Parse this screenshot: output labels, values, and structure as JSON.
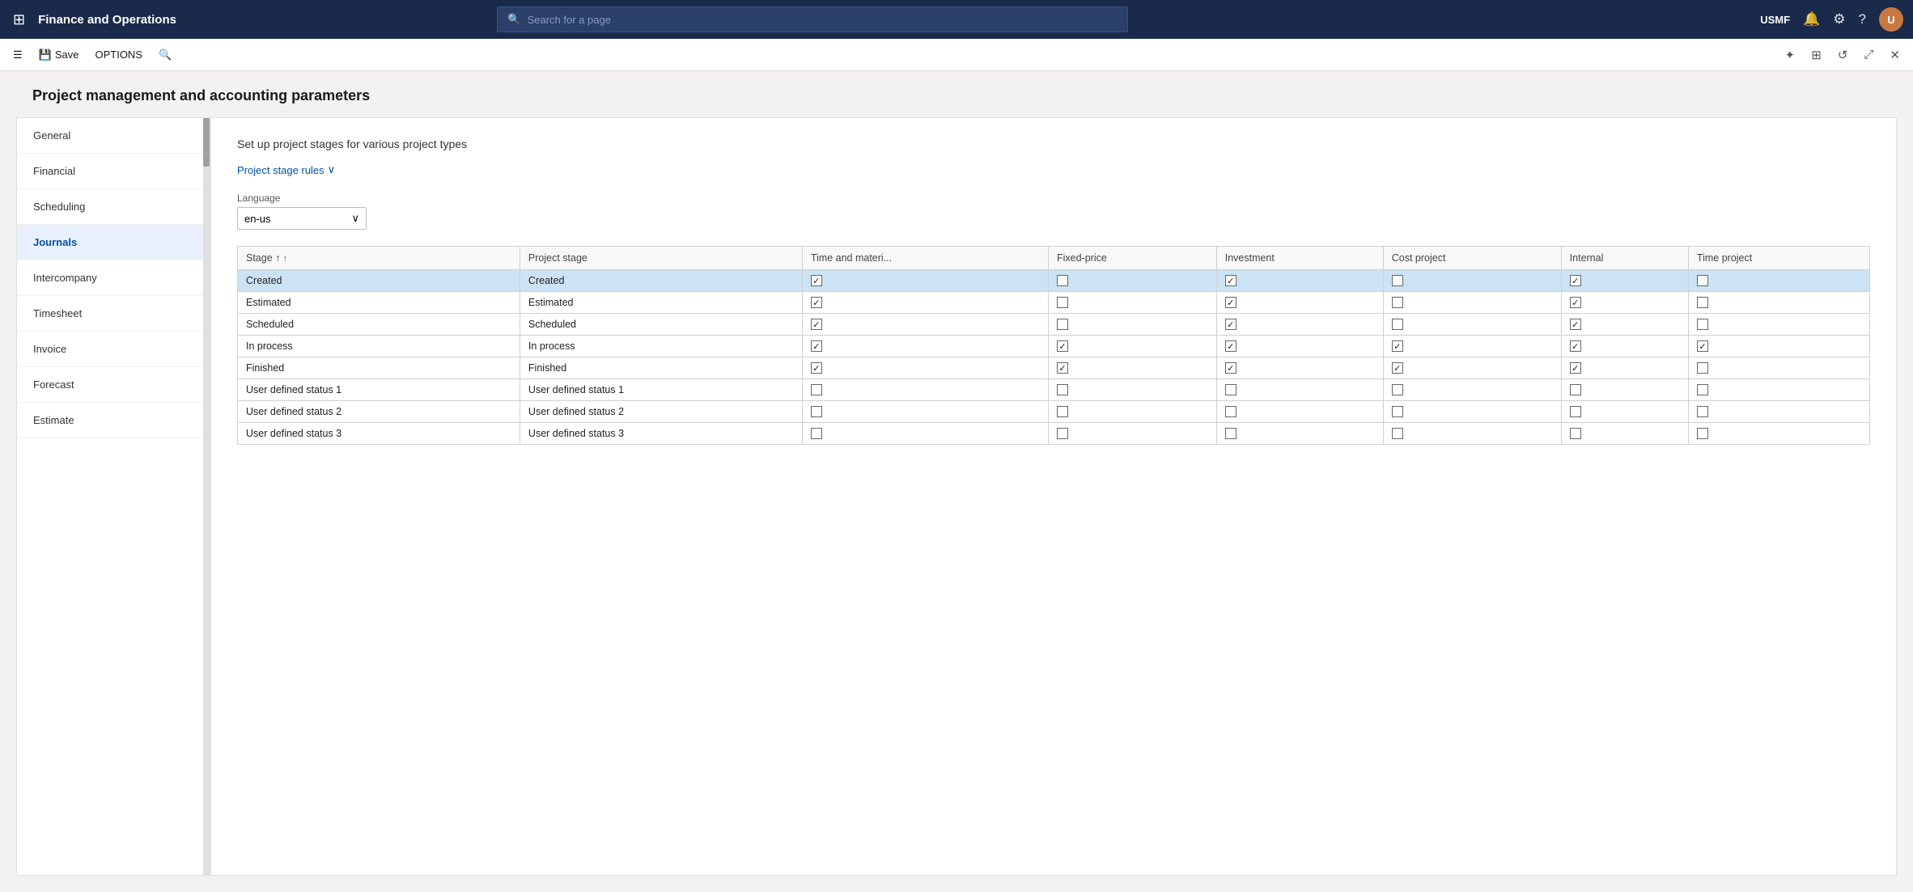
{
  "topbar": {
    "title": "Finance and Operations",
    "search_placeholder": "Search for a page",
    "user": "USMF"
  },
  "actionbar": {
    "save_label": "Save",
    "options_label": "OPTIONS"
  },
  "page": {
    "title": "Project management and accounting parameters",
    "section_heading": "Set up project stages for various project types",
    "project_stage_rules_label": "Project stage rules",
    "language_label": "Language",
    "language_value": "en-us"
  },
  "sidebar": {
    "items": [
      {
        "id": "general",
        "label": "General"
      },
      {
        "id": "financial",
        "label": "Financial"
      },
      {
        "id": "scheduling",
        "label": "Scheduling"
      },
      {
        "id": "journals",
        "label": "Journals"
      },
      {
        "id": "intercompany",
        "label": "Intercompany"
      },
      {
        "id": "timesheet",
        "label": "Timesheet"
      },
      {
        "id": "invoice",
        "label": "Invoice"
      },
      {
        "id": "forecast",
        "label": "Forecast"
      },
      {
        "id": "estimate",
        "label": "Estimate"
      }
    ]
  },
  "table": {
    "columns": [
      {
        "id": "stage",
        "label": "Stage",
        "sortable": true
      },
      {
        "id": "project_stage",
        "label": "Project stage"
      },
      {
        "id": "time_materials",
        "label": "Time and materi..."
      },
      {
        "id": "fixed_price",
        "label": "Fixed-price"
      },
      {
        "id": "investment",
        "label": "Investment"
      },
      {
        "id": "cost_project",
        "label": "Cost project"
      },
      {
        "id": "internal",
        "label": "Internal"
      },
      {
        "id": "time_project",
        "label": "Time project"
      }
    ],
    "rows": [
      {
        "stage": "Created",
        "project_stage": "Created",
        "time_materials": true,
        "fixed_price": false,
        "investment": true,
        "cost_project": false,
        "internal": true,
        "time_project": false,
        "selected": true
      },
      {
        "stage": "Estimated",
        "project_stage": "Estimated",
        "time_materials": true,
        "fixed_price": false,
        "investment": true,
        "cost_project": false,
        "internal": true,
        "time_project": false
      },
      {
        "stage": "Scheduled",
        "project_stage": "Scheduled",
        "time_materials": true,
        "fixed_price": false,
        "investment": true,
        "cost_project": false,
        "internal": true,
        "time_project": false
      },
      {
        "stage": "In process",
        "project_stage": "In process",
        "time_materials": true,
        "fixed_price": true,
        "investment": true,
        "cost_project": true,
        "internal": true,
        "time_project": true
      },
      {
        "stage": "Finished",
        "project_stage": "Finished",
        "time_materials": true,
        "fixed_price": true,
        "investment": true,
        "cost_project": true,
        "internal": true,
        "time_project": false
      },
      {
        "stage": "User defined status 1",
        "project_stage": "User defined status 1",
        "time_materials": false,
        "fixed_price": false,
        "investment": false,
        "cost_project": false,
        "internal": false,
        "time_project": false
      },
      {
        "stage": "User defined status 2",
        "project_stage": "User defined status 2",
        "time_materials": false,
        "fixed_price": false,
        "investment": false,
        "cost_project": false,
        "internal": false,
        "time_project": false
      },
      {
        "stage": "User defined status 3",
        "project_stage": "User defined status 3",
        "time_materials": false,
        "fixed_price": false,
        "investment": false,
        "cost_project": false,
        "internal": false,
        "time_project": false
      }
    ]
  }
}
